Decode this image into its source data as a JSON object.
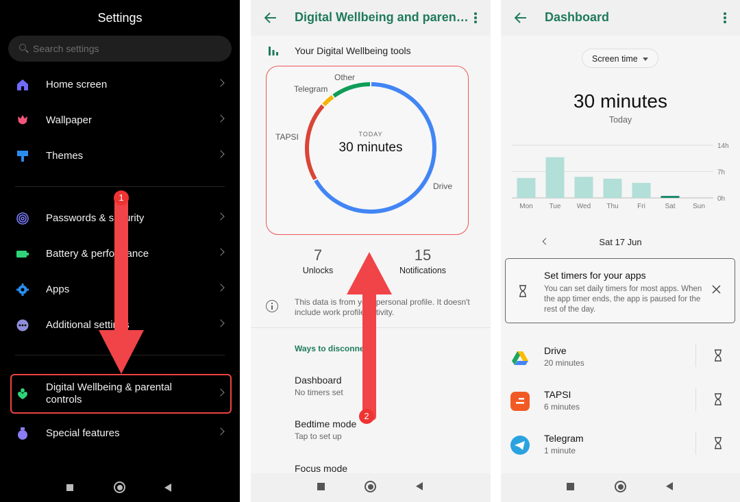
{
  "panel1": {
    "title": "Settings",
    "search_placeholder": "Search settings",
    "items": [
      {
        "label": "Home screen",
        "icon": "home-icon"
      },
      {
        "label": "Wallpaper",
        "icon": "tulip-icon"
      },
      {
        "label": "Themes",
        "icon": "brush-icon"
      },
      {
        "label": "Passwords & security",
        "icon": "fingerprint-icon"
      },
      {
        "label": "Battery & performance",
        "icon": "battery-icon"
      },
      {
        "label": "Apps",
        "icon": "gear-icon"
      },
      {
        "label": "Additional settings",
        "icon": "more-icon"
      },
      {
        "label": "Digital Wellbeing & parental controls",
        "icon": "wellbeing-heart-icon"
      },
      {
        "label": "Special features",
        "icon": "potion-icon"
      }
    ],
    "step_badge": "1"
  },
  "panel2": {
    "title": "Digital Wellbeing and paren…",
    "tools_header": "Your Digital Wellbeing tools",
    "ring": {
      "today_label": "TODAY",
      "total": "30 minutes",
      "segments": [
        {
          "label": "Drive",
          "minutes": 20,
          "color": "#4285f4"
        },
        {
          "label": "TAPSI",
          "minutes": 6,
          "color": "#db4437"
        },
        {
          "label": "Telegram",
          "minutes": 1,
          "color": "#f4b400"
        },
        {
          "label": "Other",
          "minutes": 3,
          "color": "#0f9d58"
        }
      ]
    },
    "stats": [
      {
        "value": "7",
        "label": "Unlocks"
      },
      {
        "value": "15",
        "label": "Notifications"
      }
    ],
    "info_text": "This data is from your personal profile. It doesn't include work profile activity.",
    "ways_header": "Ways to disconnect",
    "rows": [
      {
        "title": "Dashboard",
        "subtitle": "No timers set"
      },
      {
        "title": "Bedtime mode",
        "subtitle": "Tap to set up"
      },
      {
        "title": "Focus mode",
        "subtitle": ""
      }
    ],
    "step_badge": "2"
  },
  "panel3": {
    "title": "Dashboard",
    "chip_label": "Screen time",
    "total": "30 minutes",
    "total_sub": "Today",
    "chart_data": {
      "type": "bar",
      "categories": [
        "Mon",
        "Tue",
        "Wed",
        "Thu",
        "Fri",
        "Sat",
        "Sun"
      ],
      "values": [
        5.3,
        10.8,
        5.6,
        5.1,
        4.0,
        0.5,
        0
      ],
      "y_ticks": [
        "14h",
        "7h",
        "0h"
      ],
      "ylim": [
        0,
        14
      ],
      "highlight_index": 5,
      "bar_color": "#b2dfd8",
      "highlight_color": "#1f8a70"
    },
    "date": "Sat 17 Jun",
    "timer_card": {
      "title": "Set timers for your apps",
      "body": "You can set daily timers for most apps. When the app timer ends, the app is paused for the rest of the day."
    },
    "apps": [
      {
        "name": "Drive",
        "time": "20 minutes"
      },
      {
        "name": "TAPSI",
        "time": "6 minutes"
      },
      {
        "name": "Telegram",
        "time": "1 minute"
      }
    ]
  }
}
